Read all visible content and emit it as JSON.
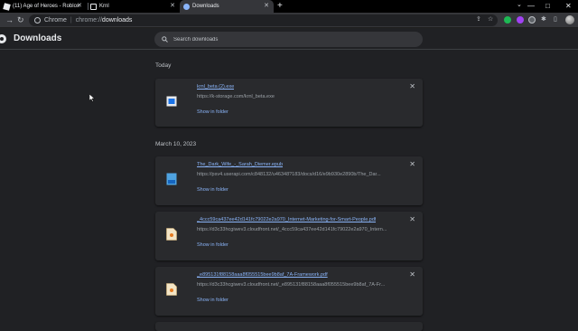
{
  "browser": {
    "tabs": [
      {
        "label": "(11) Age of Heroes - Roblox",
        "icon": "roblox-icon"
      },
      {
        "label": "Krnl",
        "icon": "krnl-icon"
      },
      {
        "label": "Downloads",
        "icon": "download-icon",
        "active": true
      }
    ],
    "window_controls": {
      "minimize": "—",
      "maximize": "□",
      "close": "✕"
    },
    "omnibox": {
      "chrome_label": "Chrome",
      "url_scheme": "chrome://",
      "url_host": "downloads"
    }
  },
  "page": {
    "title": "Downloads",
    "search_placeholder": "Search downloads"
  },
  "sections": [
    {
      "label": "Today",
      "items": [
        {
          "name": "krnl_beta (2).exe",
          "url": "https://k-storage.com/krnl_beta.exe",
          "action": "Show in folder",
          "icon": "exe-icon"
        }
      ]
    },
    {
      "label": "March 10, 2023",
      "items": [
        {
          "name": "The_Dark_Wife_-_Sarah_Diemer.epub",
          "url": "https://psv4.userapi.com/c848132/u46348?183/docs/d16/e9b930e2890b/The_Dar...",
          "action": "Show in folder",
          "icon": "epub-icon"
        },
        {
          "name": "_4ccc59ca437ee42d141fc79022e2a970_Internet-Marketing-for-Smart-People.pdf",
          "url": "https://d3c33hcgiwev3.cloudfront.net/_4ccc59ca437ee42d141fc79022e2a970_Intern...",
          "action": "Show in folder",
          "icon": "pdf-icon"
        },
        {
          "name": "_e895131f88158aaa8f055515bee9b8af_7A-Framework.pdf",
          "url": "https://d3c33hcgiwev3.cloudfront.net/_e895131f88158aaa8f055515bee9b8af_7A-Fr...",
          "action": "Show in folder",
          "icon": "pdf-icon"
        }
      ]
    }
  ],
  "colors": {
    "background": "#202124",
    "card": "#292a2d",
    "link": "#8ab4f8"
  }
}
